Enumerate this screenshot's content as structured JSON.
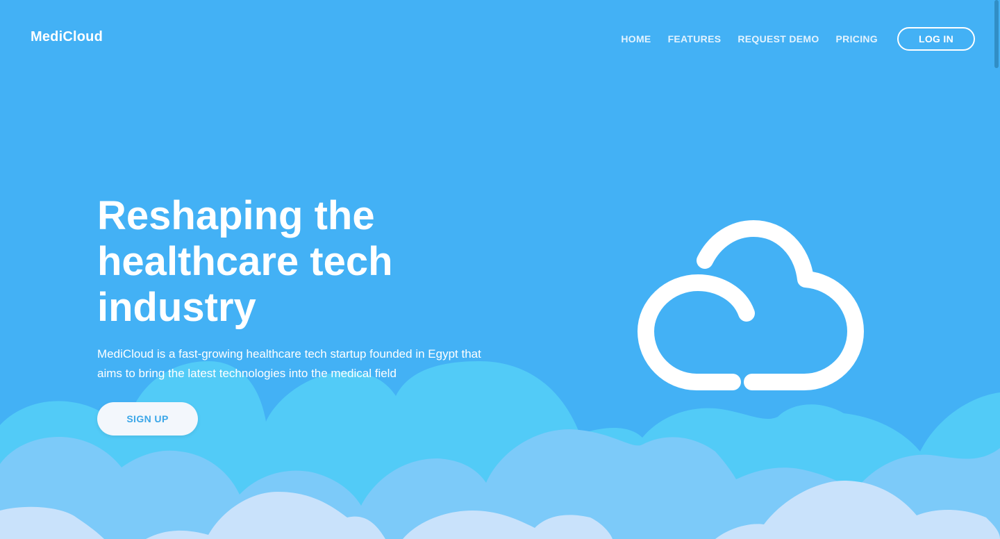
{
  "brand": {
    "name": "MediCloud"
  },
  "nav": {
    "links": [
      {
        "label": "HOME"
      },
      {
        "label": "FEATURES"
      },
      {
        "label": "REQUEST DEMO"
      },
      {
        "label": "PRICING"
      }
    ],
    "login_label": "LOG IN"
  },
  "hero": {
    "title": "Reshaping the healthcare tech industry",
    "description": "MediCloud is a fast-growing healthcare tech startup founded in Egypt that aims to bring the latest technologies into the medical field",
    "signup_label": "SIGN UP",
    "illustration_icon": "cloud-icon"
  },
  "colors": {
    "background": "#43b1f5",
    "cloud_layer_1": "#52cbf7",
    "cloud_layer_2": "#7ccaf9",
    "cloud_layer_3": "#c9e2fb",
    "button_bg": "#f3f7fc",
    "button_text": "#3aa6e8",
    "white": "#ffffff"
  }
}
